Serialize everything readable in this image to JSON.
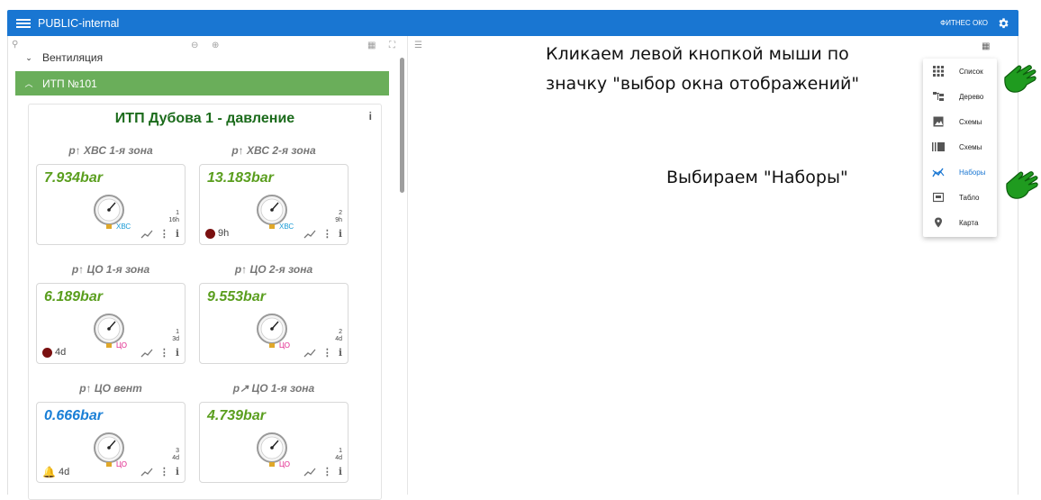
{
  "header": {
    "title": "PUBLIC-internal",
    "user": "ФИТНЕС ОКО"
  },
  "tree": {
    "vent_label": "Вентиляция",
    "itp_label": "ИТП №101"
  },
  "panel": {
    "title": "ИТП Дубова 1 - давление",
    "info": "i",
    "sensors": [
      {
        "label": "p↑ ХВС 1-я зона",
        "value": "7.934bar",
        "tag": "ХВС",
        "count_top": "1",
        "count_bottom": "16h",
        "alarm": ""
      },
      {
        "label": "p↑ ХВС 2-я зона",
        "value": "13.183bar",
        "tag": "ХВС",
        "count_top": "2",
        "count_bottom": "9h",
        "alarm": "9h"
      },
      {
        "label": "p↑ ЦО 1-я зона",
        "value": "6.189bar",
        "tag": "ЦО",
        "count_top": "1",
        "count_bottom": "3d",
        "alarm": "4d"
      },
      {
        "label": "p↑ ЦО 2-я зона",
        "value": "9.553bar",
        "tag": "ЦО",
        "count_top": "2",
        "count_bottom": "4d",
        "alarm": ""
      },
      {
        "label": "p↑ ЦО вент",
        "value": "0.666bar",
        "tag": "ЦО",
        "count_top": "3",
        "count_bottom": "4d",
        "alarm": "4d"
      },
      {
        "label": "p↗ ЦО 1-я зона",
        "value": "4.739bar",
        "tag": "ЦО",
        "count_top": "1",
        "count_bottom": "4d",
        "alarm": ""
      }
    ]
  },
  "callouts": {
    "line1": "Кликаем левой кнопкой мыши по",
    "line2": "значку \"выбор окна отображений\"",
    "line3": "Выбираем \"Наборы\""
  },
  "menu": {
    "items": [
      {
        "label": "Список",
        "icon": "grid-icon"
      },
      {
        "label": "Дерево",
        "icon": "tree-icon"
      },
      {
        "label": "Схемы",
        "icon": "image-icon"
      },
      {
        "label": "Схемы",
        "icon": "gallery-icon"
      },
      {
        "label": "Наборы",
        "icon": "chart-icon"
      },
      {
        "label": "Табло",
        "icon": "display-icon"
      },
      {
        "label": "Карта",
        "icon": "map-pin-icon"
      }
    ],
    "active_index": 4
  },
  "colors": {
    "header": "#1976d2",
    "itp_row": "#6aae5a",
    "value_green": "#5a9e1e",
    "value_blue": "#1a7fd6",
    "tag_blue": "#1a9bd6",
    "tag_pink": "#e0218a",
    "hand_green": "#1f9b1f"
  }
}
